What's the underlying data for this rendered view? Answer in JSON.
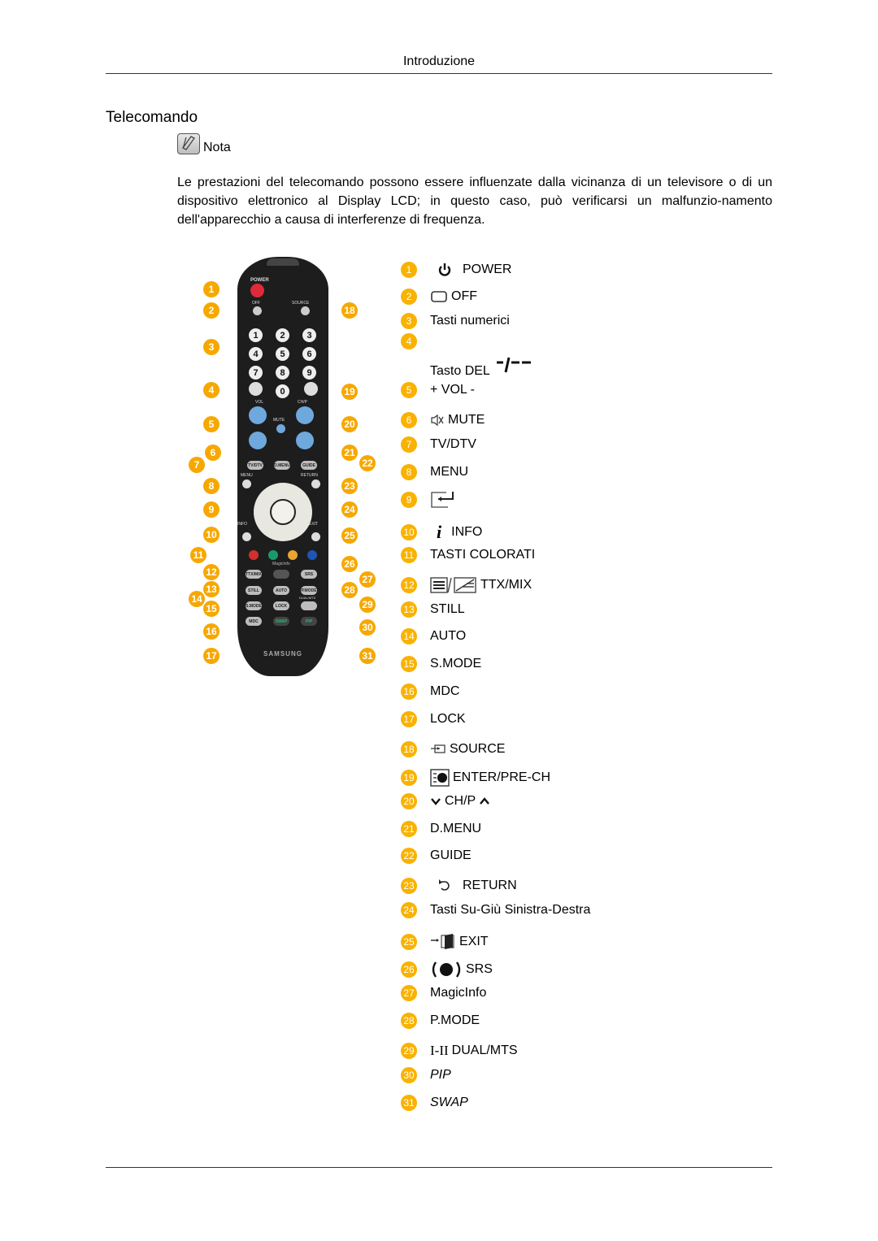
{
  "header": {
    "title": "Introduzione"
  },
  "section": {
    "title": "Telecomando"
  },
  "note": {
    "label": "Nota",
    "icon": "note-pencil-icon",
    "text": "Le prestazioni del telecomando possono essere influenzate dalla vicinanza di un televisore o di un dispositivo elettronico al Display LCD; in questo caso, può verificarsi un malfunzio-namento dell'apparecchio a causa di interferenze di frequenza."
  },
  "remote": {
    "brand": "SAMSUNG",
    "labels": {
      "power": "POWER",
      "off": "OFF",
      "source": "SOURCE",
      "vol": "VOL",
      "mute": "MUTE",
      "chp": "CH/P",
      "menu": "MENU",
      "return": "RETURN",
      "info": "INFO",
      "exit": "EXIT",
      "magicinfo": "MagicInfo",
      "dualmts": "DUAL/MTS"
    },
    "keys": {
      "tvdtv": "TV/DTV",
      "dmenu": "D.MENU",
      "guide": "GUIDE",
      "ttxmix": "TTX/MIX",
      "srs": "SRS",
      "still": "STILL",
      "auto": "AUTO",
      "pmode": "P.MODE",
      "smode": "S.MODE",
      "lock": "LOCK",
      "mdc": "MDC",
      "swap": "SWAP",
      "pip": "PIP"
    },
    "digits": [
      "1",
      "2",
      "3",
      "4",
      "5",
      "6",
      "7",
      "8",
      "9",
      "0"
    ],
    "color_buttons": [
      "#d32f2f",
      "#1a9a6a",
      "#e8a531",
      "#1f55b5"
    ]
  },
  "legend": [
    {
      "n": "1",
      "icon": "power-icon",
      "label": "POWER"
    },
    {
      "n": "2",
      "icon": "off-icon",
      "label": "OFF"
    },
    {
      "n": "3",
      "icon": "",
      "label": "Tasti numerici"
    },
    {
      "n": "4",
      "icon": "del-dash-icon",
      "label": "Tasto DEL"
    },
    {
      "n": "5",
      "icon": "",
      "label": "+ VOL -"
    },
    {
      "n": "6",
      "icon": "mute-icon",
      "label": "MUTE"
    },
    {
      "n": "7",
      "icon": "",
      "label": "TV/DTV"
    },
    {
      "n": "8",
      "icon": "",
      "label": "MENU"
    },
    {
      "n": "9",
      "icon": "enter-icon",
      "label": ""
    },
    {
      "n": "10",
      "icon": "info-icon",
      "label": "INFO"
    },
    {
      "n": "11",
      "icon": "",
      "label": "TASTI COLORATI"
    },
    {
      "n": "12",
      "icon": "ttx-mix-icon",
      "label": "TTX/MIX"
    },
    {
      "n": "13",
      "icon": "",
      "label": "STILL"
    },
    {
      "n": "14",
      "icon": "",
      "label": "AUTO"
    },
    {
      "n": "15",
      "icon": "",
      "label": "S.MODE"
    },
    {
      "n": "16",
      "icon": "",
      "label": "MDC"
    },
    {
      "n": "17",
      "icon": "",
      "label": "LOCK"
    },
    {
      "n": "18",
      "icon": "source-icon",
      "label": "SOURCE"
    },
    {
      "n": "19",
      "icon": "enter-prech-icon",
      "label": "ENTER/PRE-CH"
    },
    {
      "n": "20",
      "icon": "chevron-down-icon",
      "label": "CH/P"
    },
    {
      "n": "21",
      "icon": "",
      "label": "D.MENU"
    },
    {
      "n": "22",
      "icon": "",
      "label": "GUIDE"
    },
    {
      "n": "23",
      "icon": "return-icon",
      "label": "RETURN"
    },
    {
      "n": "24",
      "icon": "",
      "label": "Tasti Su-Giù Sinistra-Destra"
    },
    {
      "n": "25",
      "icon": "exit-icon",
      "label": "EXIT"
    },
    {
      "n": "26",
      "icon": "srs-icon",
      "label": "SRS"
    },
    {
      "n": "27",
      "icon": "",
      "label": "MagicInfo"
    },
    {
      "n": "28",
      "icon": "",
      "label": "P.MODE"
    },
    {
      "n": "29",
      "icon": "dual-mts-icon",
      "label": "DUAL/MTS"
    },
    {
      "n": "30",
      "icon": "",
      "label": "PIP"
    },
    {
      "n": "31",
      "icon": "",
      "label": "SWAP"
    }
  ]
}
